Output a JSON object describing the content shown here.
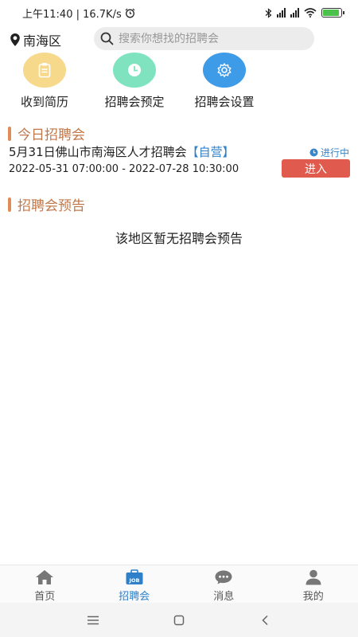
{
  "status_bar": {
    "time_speed": "上午11:40 | 16.7K/s",
    "battery_level": 0.9
  },
  "header": {
    "location": "南海区",
    "search_placeholder": "搜索你想找的招聘会"
  },
  "features": [
    {
      "label": "收到简历",
      "icon": "clipboard-icon",
      "color": "#f7d98c"
    },
    {
      "label": "招聘会预定",
      "icon": "clock-icon",
      "color": "#7fe3bf"
    },
    {
      "label": "招聘会设置",
      "icon": "gear-icon",
      "color": "#3d9be8"
    }
  ],
  "today_section": {
    "title": "今日招聘会",
    "fair": {
      "name": "5月31日佛山市南海区人才招聘会",
      "tag": "【自营】",
      "time_range": "2022-05-31 07:00:00 - 2022-07-28 10:30:00",
      "status": "进行中",
      "enter_label": "进入"
    }
  },
  "preview_section": {
    "title": "招聘会预告",
    "empty_text": "该地区暂无招聘会预告"
  },
  "tabbar": {
    "tabs": [
      {
        "label": "首页",
        "icon": "home-icon"
      },
      {
        "label": "招聘会",
        "icon": "job-icon",
        "active": true
      },
      {
        "label": "消息",
        "icon": "message-icon"
      },
      {
        "label": "我的",
        "icon": "person-icon"
      }
    ],
    "active_color": "#2f7fc9"
  },
  "colors": {
    "section_title": "#c0784a",
    "enter_button": "#e05a4e",
    "tag_blue": "#2f7fc9"
  }
}
